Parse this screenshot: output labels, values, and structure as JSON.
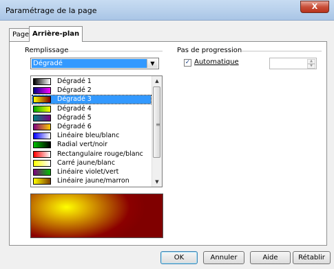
{
  "window": {
    "title": "Paramétrage de la page",
    "close_label": "X"
  },
  "tabs": [
    {
      "label": "Page"
    },
    {
      "label": "Arrière-plan"
    }
  ],
  "fill": {
    "group_label": "Remplissage",
    "combo_value": "Dégradé",
    "gradients": [
      {
        "label": "Dégradé 1",
        "colors": [
          "#000000",
          "#ffffff"
        ]
      },
      {
        "label": "Dégradé 2",
        "colors": [
          "#000080",
          "#ff00ff"
        ]
      },
      {
        "label": "Dégradé 3",
        "colors": [
          "#ffff00",
          "#800000"
        ]
      },
      {
        "label": "Dégradé 4",
        "colors": [
          "#00aa00",
          "#ffff00"
        ]
      },
      {
        "label": "Dégradé 5",
        "colors": [
          "#008080",
          "#800080"
        ]
      },
      {
        "label": "Dégradé 6",
        "colors": [
          "#800080",
          "#ffcc00"
        ]
      },
      {
        "label": "Linéaire bleu/blanc",
        "colors": [
          "#0000ff",
          "#ffffff"
        ]
      },
      {
        "label": "Radial vert/noir",
        "colors": [
          "#00c000",
          "#000000"
        ]
      },
      {
        "label": "Rectangulaire rouge/blanc",
        "colors": [
          "#ff0000",
          "#ffffff"
        ]
      },
      {
        "label": "Carré jaune/blanc",
        "colors": [
          "#ffff00",
          "#ffffff"
        ]
      },
      {
        "label": "Linéaire violet/vert",
        "colors": [
          "#800080",
          "#00c000"
        ]
      },
      {
        "label": "Linéaire jaune/marron",
        "colors": [
          "#ffff00",
          "#804000"
        ]
      }
    ],
    "selected_index": 2
  },
  "step": {
    "group_label": "Pas de progression",
    "auto_label": "Automatique",
    "auto_checked": true,
    "check_mark": "✓"
  },
  "buttons": {
    "ok": "OK",
    "cancel": "Annuler",
    "help": "Aide",
    "reset": "Rétablir"
  }
}
